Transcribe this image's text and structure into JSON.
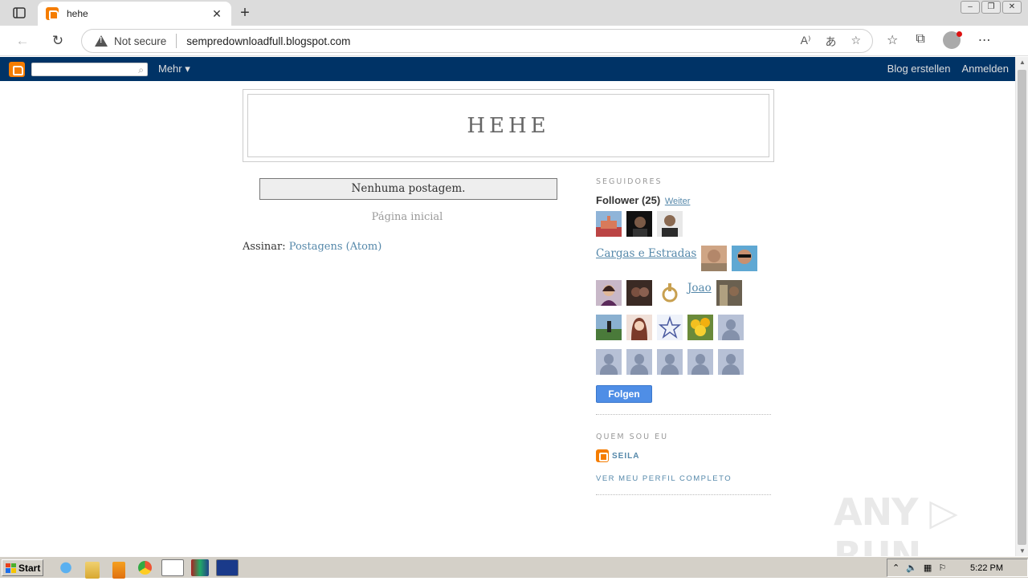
{
  "browser": {
    "tab_title": "hehe",
    "new_tab_symbol": "+",
    "close_symbol": "✕",
    "security_label": "Not secure",
    "url": "sempredownloadfull.blogspot.com"
  },
  "blogger_nav": {
    "more_label": "Mehr ▾",
    "create_blog": "Blog erstellen",
    "sign_in": "Anmelden"
  },
  "blog": {
    "title": "HEHE",
    "no_posts": "Nenhuma postagem.",
    "home_link": "Página inicial",
    "subscribe_label": "Assinar:",
    "subscribe_link": "Postagens (Atom)"
  },
  "followers": {
    "section_title": "SEGUIDORES",
    "heading": "Follower (25)",
    "more_link": "Weiter",
    "broken_link_1": "Cargas e Estradas",
    "broken_link_2": "Joao",
    "follow_button": "Folgen"
  },
  "about": {
    "section_title": "QUEM SOU EU",
    "name": "SEILA",
    "profile_link": "VER MEU PERFIL COMPLETO"
  },
  "watermark": "ANY ▷ RUN",
  "taskbar": {
    "start_label": "Start",
    "clock": "5:22 PM"
  },
  "colors": {
    "blogger_orange": "#f57d00",
    "navbar_blue": "#003366",
    "link_blue": "#5588aa",
    "follow_button": "#4f8ee6"
  }
}
